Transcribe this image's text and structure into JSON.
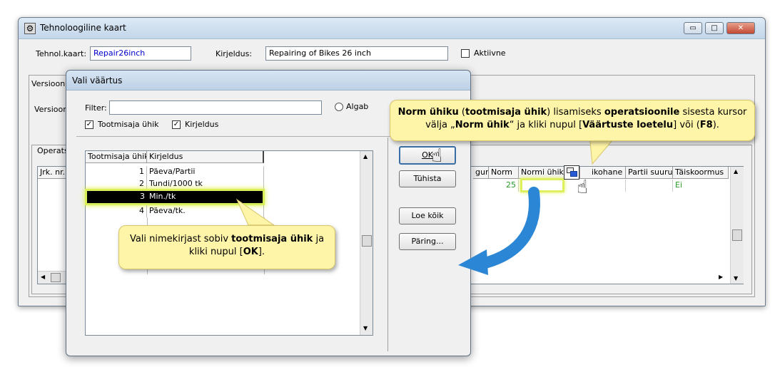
{
  "main_window": {
    "title": "Tehnoloogiline kaart",
    "controls": {
      "minimize": "▭",
      "maximize": "□",
      "close": "✕"
    },
    "tehnol_kaart_label": "Tehnol.kaart:",
    "tehnol_kaart_value": "Repair26inch",
    "kirjeldus_label": "Kirjeldus:",
    "kirjeldus_value": "Repairing of Bikes 26 inch",
    "aktiivne_label": "Aktiivne",
    "versioon_tab_label": "Versiooni",
    "versioon_label": "Versioon",
    "operats_label": "Operats",
    "grid": {
      "left_header": "Jrk. nr.",
      "columns": [
        "gur",
        "Norm",
        "Normi ühik",
        "ikohane",
        "Partii suurus",
        "Täiskoormus"
      ],
      "row": {
        "norm": "25",
        "taiskoormus": "Ei"
      }
    }
  },
  "dialog": {
    "title": "Vali väärtus",
    "filter_label": "Filter:",
    "filter_value": "",
    "algab_label": "Algab",
    "checkbox_tootmisaja": "Tootmisaja ühik",
    "checkbox_kirjeldus": "Kirjeldus",
    "table": {
      "headers": [
        "Tootmisaja ühik",
        "Kirjeldus"
      ],
      "rows": [
        {
          "id": "1",
          "desc": "Päeva/Partii"
        },
        {
          "id": "2",
          "desc": "Tundi/1000 tk"
        },
        {
          "id": "3",
          "desc": "Min./tk"
        },
        {
          "id": "4",
          "desc": "Päeva/tk."
        }
      ]
    },
    "buttons": {
      "ok": "OK",
      "tuhista": "Tühista",
      "loe_koik": "Loe kõik",
      "paring": "Päring..."
    }
  },
  "callouts": {
    "top": {
      "p1": "Norm ühiku",
      "p2": " (",
      "p3": "tootmisaja ühik",
      "p4": ") lisamiseks ",
      "p5": "operatsioonile",
      "p6": " sisesta kursor välja „",
      "p7": "Norm ühik",
      "p8": "“ ja kliki nupul [",
      "p9": "Väärtuste loetelu",
      "p10": "] või (",
      "p11": "F8",
      "p12": ")."
    },
    "bottom": {
      "p1": "Vali nimekirjast sobiv ",
      "p2": "tootmisaja ühik",
      "p3": " ja kliki nupul [",
      "p4": "OK",
      "p5": "]."
    }
  },
  "colors": {
    "accent_highlight": "#dff05f",
    "callout_bg": "#fff5a8",
    "arrow": "#2b86d6"
  }
}
